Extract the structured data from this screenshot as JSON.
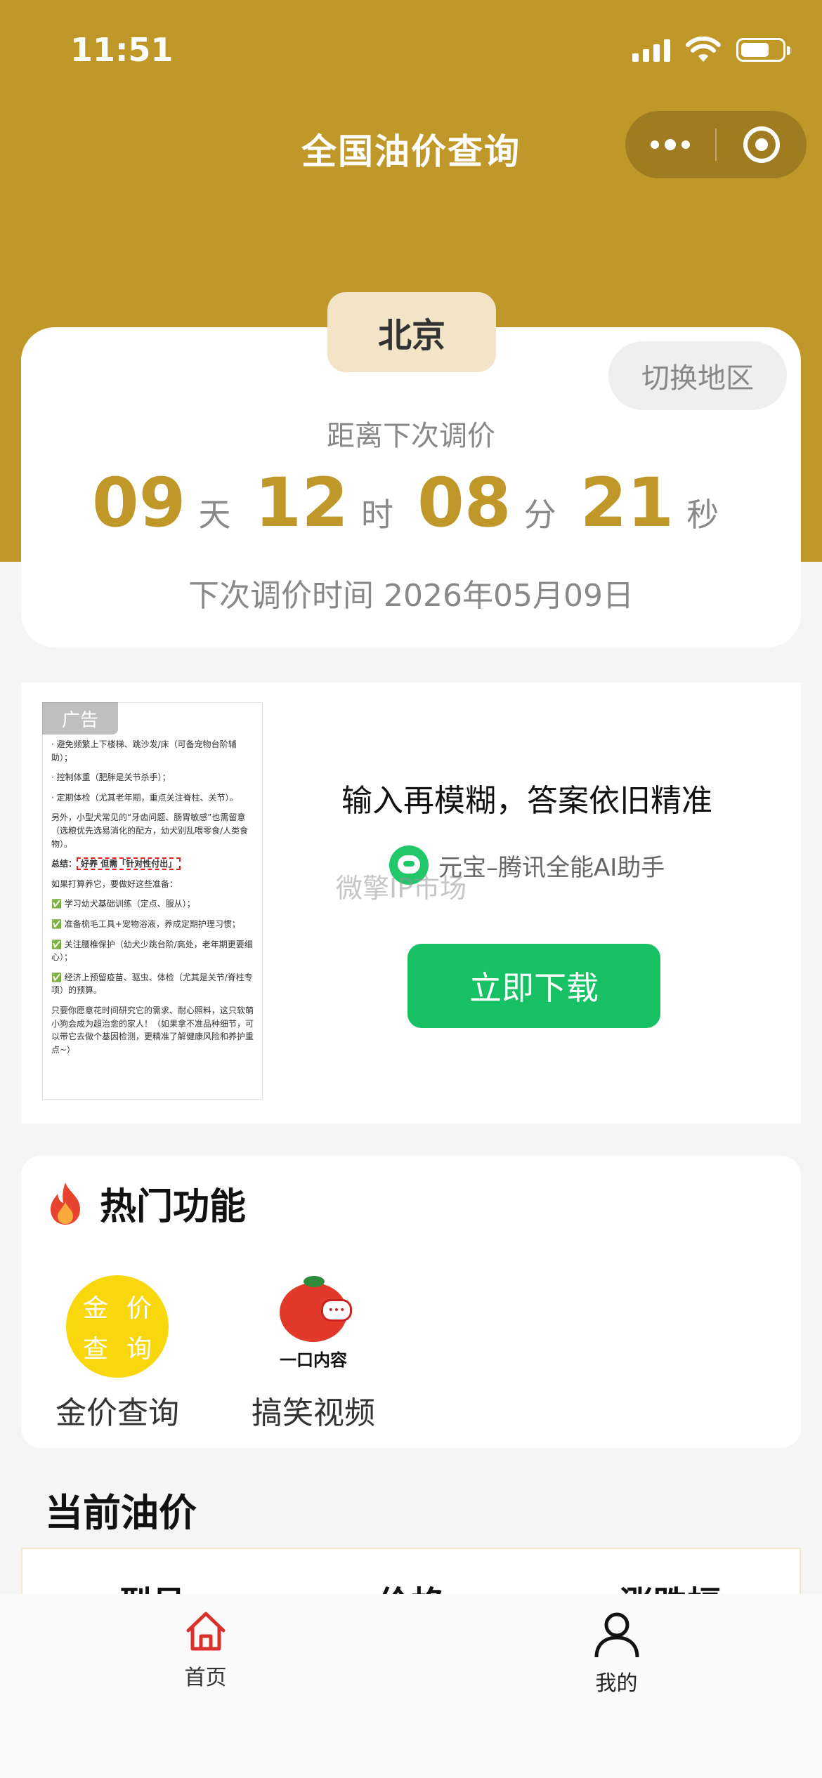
{
  "status_bar": {
    "time": "11:51"
  },
  "header": {
    "title": "全国油价查询"
  },
  "countdown": {
    "city": "北京",
    "switch_label": "切换地区",
    "label": "距离下次调价",
    "days": "09",
    "days_unit": "天",
    "hours": "12",
    "hours_unit": "时",
    "minutes": "08",
    "minutes_unit": "分",
    "seconds": "21",
    "seconds_unit": "秒",
    "next_date": "下次调价时间 2026年05月09日"
  },
  "ad": {
    "badge": "广告",
    "headline": "输入再模糊，答案依旧精准",
    "brand": "元宝–腾讯全能AI助手",
    "watermark": "微擎IP市场",
    "button": "立即下载",
    "thumb": {
      "p1": "· 避免频繁上下楼梯、跳沙发/床（可备宠物台阶辅助）；",
      "p2": "· 控制体重（肥胖是关节杀手）；",
      "p3": "· 定期体检（尤其老年期，重点关注脊柱、关节）。",
      "p4": "另外，小型犬常见的“牙齿问题、肠胃敏感”也需留意（选粮优先选易消化的配方，幼犬别乱喂零食/人类食物）。",
      "summary_prefix": "总结：",
      "summary_a": "好养",
      "summary_b": "但需「针对性付出」",
      "p5": "如果打算养它，要做好这些准备：",
      "c1": "学习幼犬基础训练（定点、服从）；",
      "c2": "准备梳毛工具+宠物浴液，养成定期护理习惯；",
      "c3": "关注腰椎保护（幼犬少跳台阶/高处，老年期更要细心）；",
      "c4": "经济上预留疫苗、驱虫、体检（尤其是关节/脊柱专项）的预算。",
      "p6": "只要你愿意花时间研究它的需求、耐心照料，这只软萌小狗会成为超治愈的家人！（如果拿不准品种细节，可以带它去做个基因检测，更精准了解健康风险和养护重点~）"
    }
  },
  "hot": {
    "title": "热门功能",
    "items": [
      {
        "label": "金价查询",
        "icon_text": [
          "金",
          "价",
          "查",
          "询"
        ]
      },
      {
        "label": "搞笑视频",
        "icon_text": "一口内容"
      }
    ]
  },
  "oil": {
    "title": "当前油价",
    "columns": [
      "型号",
      "价格",
      "涨跌幅"
    ]
  },
  "tabbar": {
    "items": [
      {
        "label": "首页",
        "icon": "home-icon"
      },
      {
        "label": "我的",
        "icon": "user-icon"
      }
    ]
  },
  "colors": {
    "brand": "#c0982a",
    "download": "#18c164",
    "home_active": "#d9302b"
  }
}
